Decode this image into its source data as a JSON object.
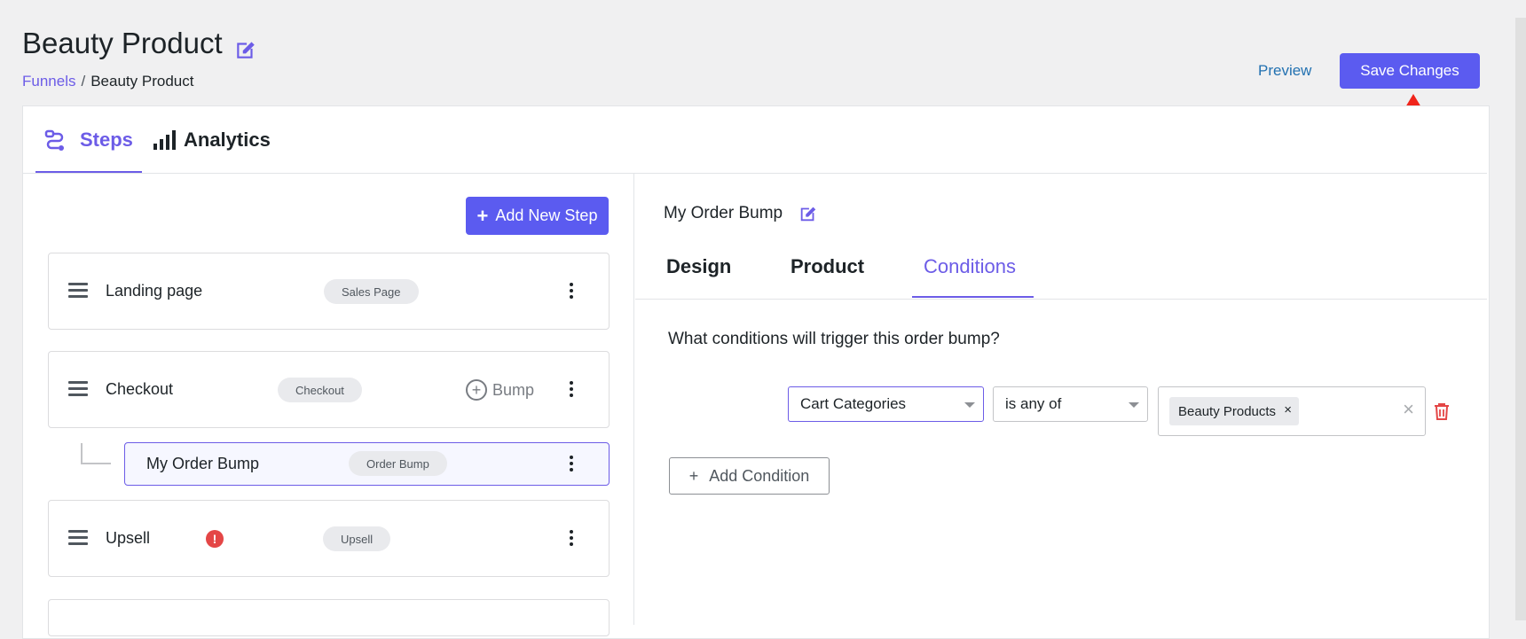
{
  "header": {
    "title": "Beauty Product",
    "breadcrumb": {
      "root": "Funnels",
      "separator": "/",
      "current": "Beauty Product"
    },
    "preview_label": "Preview",
    "save_label": "Save Changes"
  },
  "tabs": [
    {
      "label": "Steps",
      "icon": "flow-icon",
      "active": true
    },
    {
      "label": "Analytics",
      "icon": "bar-chart-icon",
      "active": false
    }
  ],
  "steps_panel": {
    "add_step_label": "Add New Step",
    "steps": [
      {
        "name": "Landing page",
        "badge": "Sales Page"
      },
      {
        "name": "Checkout",
        "badge": "Checkout",
        "bump_label": "Bump"
      },
      {
        "name": "Upsell",
        "badge": "Upsell",
        "warning": true
      }
    ],
    "order_bump": {
      "name": "My Order Bump",
      "badge": "Order Bump"
    }
  },
  "editor": {
    "title": "My Order Bump",
    "tabs": [
      "Design",
      "Product",
      "Conditions"
    ],
    "active_tab": "Conditions",
    "question": "What conditions will trigger this order bump?",
    "condition": {
      "field": "Cart Categories",
      "operator": "is any of",
      "values": [
        "Beauty Products"
      ],
      "chip_remove": "×",
      "clear_all": "×"
    },
    "add_condition_label": "Add Condition"
  },
  "colors": {
    "accent": "#5b5bf0",
    "annotation_arrow": "#f0241b",
    "danger": "#e44646"
  }
}
